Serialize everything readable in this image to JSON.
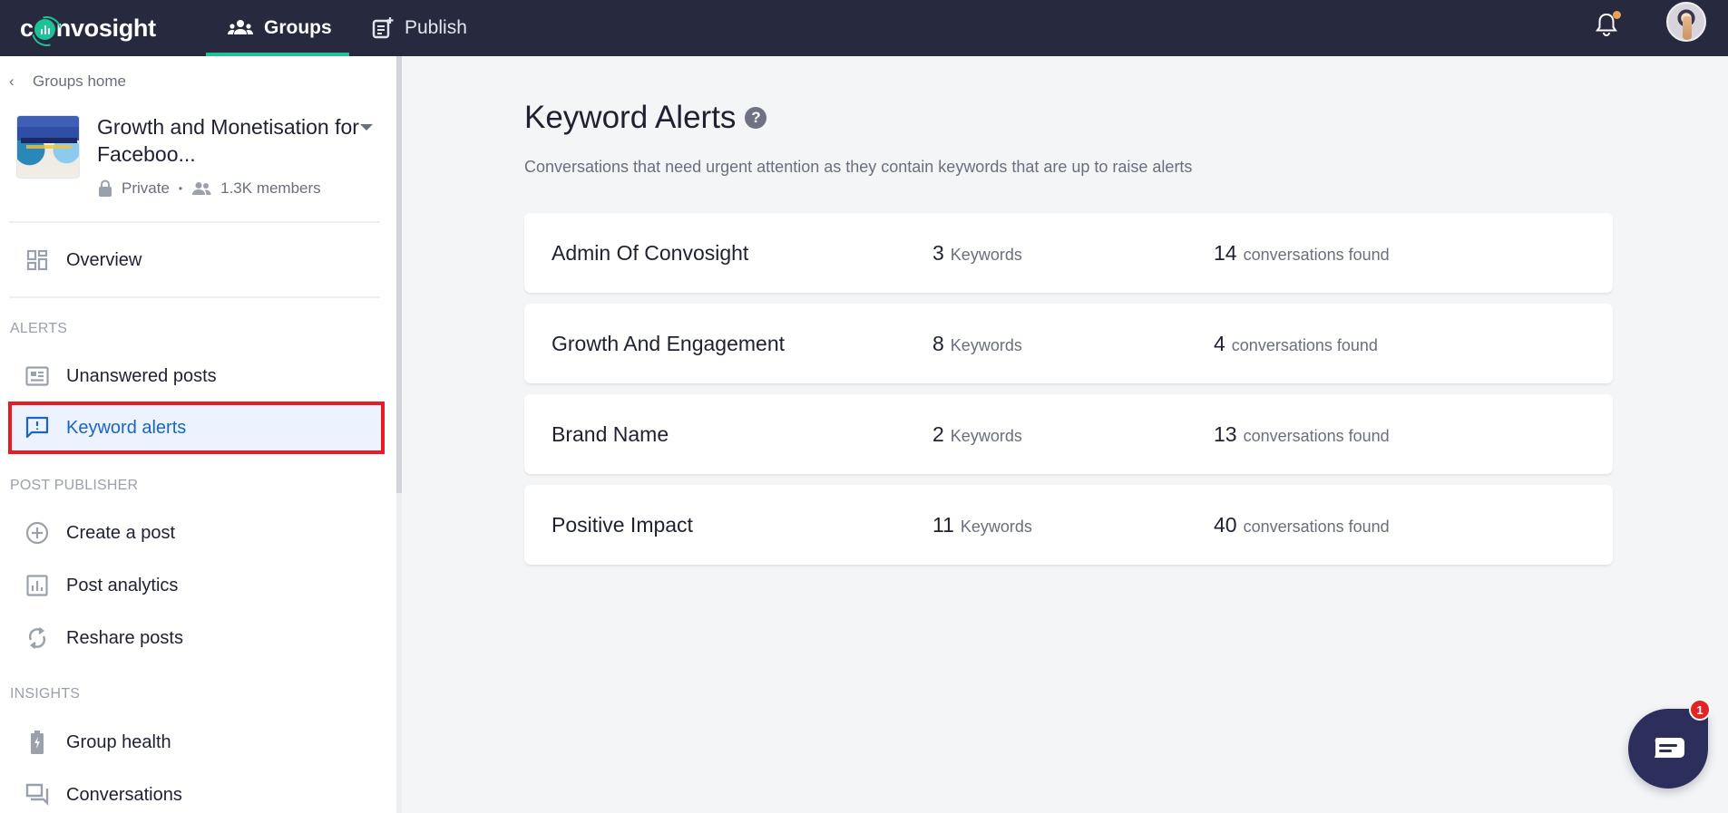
{
  "header": {
    "logo": {
      "prefix": "c",
      "suffix": "nvosight"
    },
    "nav": [
      {
        "label": "Groups",
        "icon": "groups-icon",
        "active": true
      },
      {
        "label": "Publish",
        "icon": "publish-icon",
        "active": false
      }
    ],
    "notifications": {
      "icon": "bell-icon",
      "has_unread": true
    },
    "avatar": {
      "icon": "user-avatar"
    }
  },
  "sidebar": {
    "back_link": "Groups home",
    "group": {
      "name": "Growth and Monetisation for Faceboo...",
      "privacy": "Private",
      "members": "1.3K members"
    },
    "overview": {
      "label": "Overview",
      "icon": "overview-icon"
    },
    "sections": [
      {
        "title": "ALERTS",
        "items": [
          {
            "label": "Unanswered posts",
            "icon": "unanswered-posts-icon",
            "active": false
          },
          {
            "label": "Keyword alerts",
            "icon": "keyword-alert-icon",
            "active": true
          }
        ]
      },
      {
        "title": "POST PUBLISHER",
        "items": [
          {
            "label": "Create a post",
            "icon": "plus-circle-icon",
            "active": false
          },
          {
            "label": "Post analytics",
            "icon": "analytics-icon",
            "active": false
          },
          {
            "label": "Reshare posts",
            "icon": "reshare-icon",
            "active": false
          }
        ]
      },
      {
        "title": "INSIGHTS",
        "items": [
          {
            "label": "Group health",
            "icon": "battery-health-icon",
            "active": false
          },
          {
            "label": "Conversations",
            "icon": "conversations-icon",
            "active": false
          }
        ]
      }
    ]
  },
  "main": {
    "title": "Keyword Alerts",
    "help_icon": "?",
    "subtitle": "Conversations that need urgent attention as they contain keywords that are up to raise alerts",
    "alerts": [
      {
        "name": "Admin Of Convosight",
        "keywords": "3",
        "keywords_unit": "Keywords",
        "conversations": "14",
        "conversations_unit": "conversations found"
      },
      {
        "name": "Growth And Engagement",
        "keywords": "8",
        "keywords_unit": "Keywords",
        "conversations": "4",
        "conversations_unit": "conversations found"
      },
      {
        "name": "Brand Name",
        "keywords": "2",
        "keywords_unit": "Keywords",
        "conversations": "13",
        "conversations_unit": "conversations found"
      },
      {
        "name": "Positive Impact",
        "keywords": "11",
        "keywords_unit": "Keywords",
        "conversations": "40",
        "conversations_unit": "conversations found"
      }
    ]
  },
  "chat_widget": {
    "badge_count": "1",
    "icon": "chat-icon"
  },
  "colors": {
    "header_bg": "#272a3f",
    "accent_green": "#1fc196",
    "active_blue": "#1a64c8",
    "active_bg": "#edf3fe",
    "highlight_red": "#e61b23",
    "notification_dot": "#e9a153",
    "chat_bg": "#2c2f5c",
    "chat_badge": "#e42424"
  }
}
